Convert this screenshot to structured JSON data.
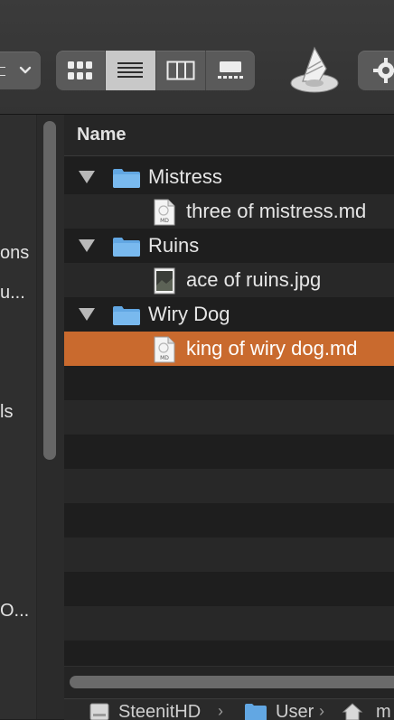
{
  "toolbar": {
    "group_popup": {
      "icon": "group-lines-icon",
      "chevron": "chevron-down-icon"
    },
    "view_modes": [
      {
        "id": "icon",
        "icon": "grid-icon",
        "active": false
      },
      {
        "id": "list",
        "icon": "list-icon",
        "active": true
      },
      {
        "id": "columns",
        "icon": "columns-icon",
        "active": false
      },
      {
        "id": "gallery",
        "icon": "gallery-icon",
        "active": false
      }
    ],
    "script_icon": "script-icon",
    "action_icon": "gear-icon"
  },
  "sidebar": {
    "items": [
      {
        "label": "ons"
      },
      {
        "label": "u..."
      },
      {
        "label": "ls"
      },
      {
        "label": "O..."
      }
    ]
  },
  "list": {
    "column_header": "Name",
    "rows": [
      {
        "type": "folder",
        "name": "Mistress",
        "expanded": true
      },
      {
        "type": "file",
        "name": "three of mistress.md",
        "icon": "markdown-file-icon",
        "icon_label": "MD"
      },
      {
        "type": "folder",
        "name": "Ruins",
        "expanded": true
      },
      {
        "type": "file",
        "name": "ace of ruins.jpg",
        "icon": "image-file-icon"
      },
      {
        "type": "folder",
        "name": "Wiry Dog",
        "expanded": true
      },
      {
        "type": "file",
        "name": "king of wiry dog.md",
        "icon": "markdown-file-icon",
        "icon_label": "MD",
        "selected": true
      }
    ]
  },
  "pathbar": {
    "crumbs": [
      {
        "label": "SteenitHD",
        "icon": "disk-icon"
      },
      {
        "label": "User",
        "icon": "folder-icon"
      },
      {
        "label": "m",
        "icon": "home-icon"
      }
    ]
  },
  "colors": {
    "selection": "#c96a2e",
    "folder": "#62a7e3",
    "background": "#1e1e1e"
  }
}
